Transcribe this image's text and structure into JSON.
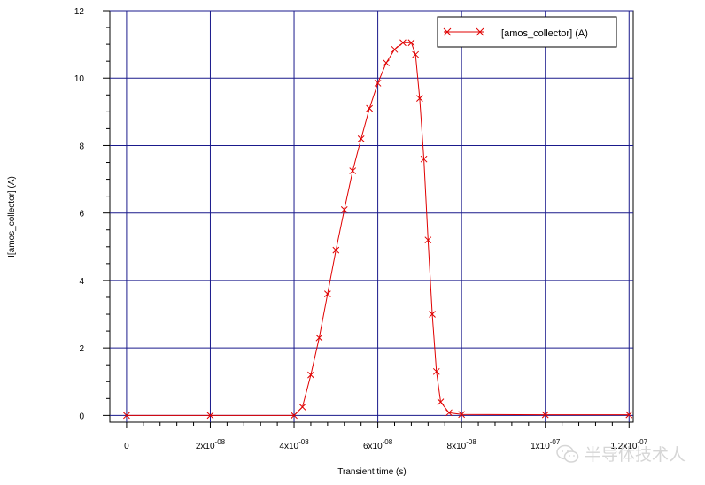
{
  "chart_data": {
    "type": "scatter",
    "xlabel": "Transient time (s)",
    "ylabel": "I[amos_collector] (A)",
    "xlim": [
      -4e-09,
      1.21e-07
    ],
    "ylim": [
      -0.2,
      12
    ],
    "xticks": [
      {
        "value": 0,
        "label": "0"
      },
      {
        "value": 2e-08,
        "label": "2x10-08"
      },
      {
        "value": 4e-08,
        "label": "4x10-08"
      },
      {
        "value": 6e-08,
        "label": "6x10-08"
      },
      {
        "value": 8e-08,
        "label": "8x10-08"
      },
      {
        "value": 1e-07,
        "label": "1x10-07"
      },
      {
        "value": 1.2e-07,
        "label": "1.2x10-07"
      }
    ],
    "yticks": [
      0,
      2,
      4,
      6,
      8,
      10,
      12
    ],
    "grid": true,
    "legend_position": "top-right",
    "series": [
      {
        "name": "I[amos_collector] (A)",
        "color": "#e00000",
        "marker": "x",
        "points": [
          [
            0,
            0
          ],
          [
            2e-08,
            0
          ],
          [
            4e-08,
            0
          ],
          [
            4.2e-08,
            0.25
          ],
          [
            4.4e-08,
            1.2
          ],
          [
            4.6e-08,
            2.3
          ],
          [
            4.8e-08,
            3.6
          ],
          [
            5e-08,
            4.9
          ],
          [
            5.2e-08,
            6.1
          ],
          [
            5.4e-08,
            7.25
          ],
          [
            5.6e-08,
            8.2
          ],
          [
            5.8e-08,
            9.1
          ],
          [
            6e-08,
            9.85
          ],
          [
            6.2e-08,
            10.45
          ],
          [
            6.4e-08,
            10.85
          ],
          [
            6.6e-08,
            11.05
          ],
          [
            6.8e-08,
            11.05
          ],
          [
            6.9e-08,
            10.7
          ],
          [
            7e-08,
            9.4
          ],
          [
            7.1e-08,
            7.6
          ],
          [
            7.2e-08,
            5.2
          ],
          [
            7.3e-08,
            3.0
          ],
          [
            7.4e-08,
            1.3
          ],
          [
            7.5e-08,
            0.4
          ],
          [
            7.7e-08,
            0.08
          ],
          [
            8e-08,
            0.03
          ],
          [
            1e-07,
            0.02
          ],
          [
            1.2e-07,
            0.02
          ]
        ]
      }
    ]
  },
  "watermark": {
    "text": "半导体技术人"
  }
}
